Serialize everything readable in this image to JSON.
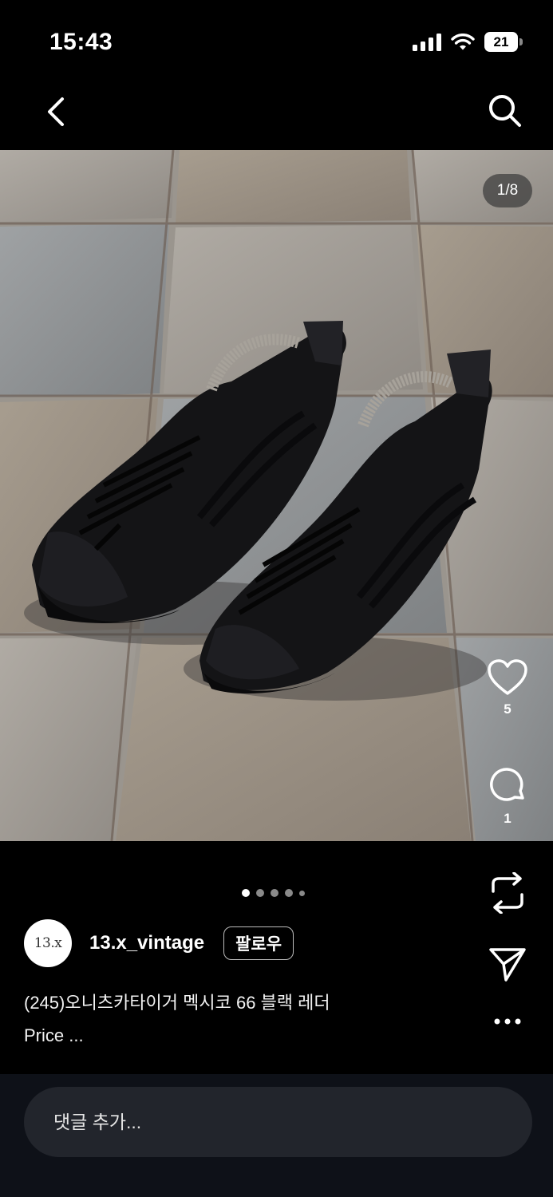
{
  "status_bar": {
    "time": "15:43",
    "battery": "21"
  },
  "nav": {
    "back_icon": "chevron-left-icon",
    "search_icon": "search-icon"
  },
  "photo": {
    "counter": "1/8",
    "dot_count": 5,
    "active_index": 0
  },
  "actions": {
    "likes": "5",
    "comments": "1",
    "icons": [
      "heart-icon",
      "comment-icon",
      "repost-icon",
      "send-icon",
      "more-icon"
    ]
  },
  "author": {
    "avatar_text": "13.x",
    "username": "13.x_vintage",
    "follow_label": "팔로우"
  },
  "caption": {
    "line1": "(245)오니츠카타이거 멕시코 66 블랙 레더",
    "line2": "Price ..."
  },
  "comment": {
    "placeholder": "댓글 추가..."
  },
  "colors": {
    "background": "#000000",
    "comment_bar": "#0e1118",
    "comment_field": "#22252c"
  }
}
